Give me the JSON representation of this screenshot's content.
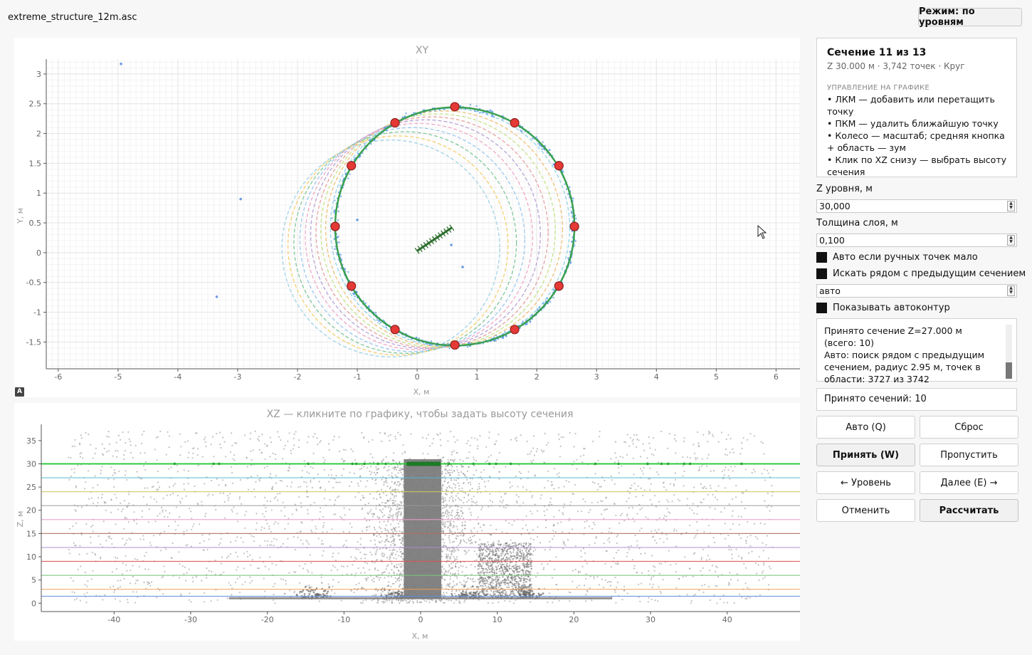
{
  "window": {
    "filename": "extreme_structure_12m.asc"
  },
  "toolbar": {
    "mode_label": "Режим: по уровням"
  },
  "xy_plot": {
    "title": "XY",
    "xlabel": "X, м",
    "ylabel": "Y, м",
    "xticks": [
      "-6",
      "-5",
      "-4",
      "-3",
      "-2",
      "-1",
      "0",
      "1",
      "2",
      "3",
      "4",
      "5",
      "6"
    ],
    "yticks": [
      "3",
      "2.5",
      "2",
      "1.5",
      "1",
      "0.5",
      "0",
      "-0.5",
      "-1",
      "-1.5"
    ],
    "badge": "A"
  },
  "xz_plot": {
    "title": "XZ — кликните по графику, чтобы задать высоту сечения",
    "xlabel": "X, м",
    "ylabel": "Z, м",
    "xticks": [
      "-40",
      "-30",
      "-20",
      "-10",
      "0",
      "10",
      "20",
      "30",
      "40"
    ],
    "yticks": [
      "35",
      "30",
      "25",
      "20",
      "15",
      "10",
      "5",
      "0"
    ]
  },
  "info": {
    "title": "Сечение 11 из 13",
    "subtitle": "Z 30.000 м · 3,742 точек · Круг",
    "controls_heading": "УПРАВЛЕНИЕ НА ГРАФИКЕ",
    "hint1": "• ЛКМ — добавить или перетащить точку",
    "hint2": "• ПКМ — удалить ближайшую точку",
    "hint3": "• Колесо — масштаб; средняя кнопка + область — зум",
    "hint4": "• Клик по XZ снизу — выбрать высоту сечения"
  },
  "form": {
    "z_label": "Z уровня, м",
    "z_value": "30,000",
    "thickness_label": "Толщина слоя, м",
    "thickness_value": "0,100",
    "auto_if_few": "Авто если ручных точек мало",
    "search_near_prev": "Искать рядом с предыдущим сечением",
    "auto_value": "авто",
    "show_autocontour": "Показывать автоконтур"
  },
  "log": {
    "line1": "Принято сечение Z=27.000 м (всего: 10)",
    "line2": "Авто: поиск рядом с предыдущим сечением, радиус 2.95 м, точек в области: 3727 из 3742"
  },
  "status": {
    "accepted": "Принято сечений: 10"
  },
  "buttons": {
    "auto": "Авто (Q)",
    "reset": "Сброс",
    "accept": "Принять (W)",
    "skip": "Пропустить",
    "prev_level": "← Уровень",
    "next": "Далее (E) →",
    "undo": "Отменить",
    "compute": "Рассчитать"
  },
  "colors": {
    "contour": "#3aa050",
    "control_point": "#e53935",
    "current_level": "#2ecc40",
    "scatter": "#888888"
  },
  "chart_data": [
    {
      "type": "scatter",
      "title": "XY",
      "xlabel": "X, м",
      "ylabel": "Y, м",
      "xlim": [
        -6.2,
        6.4
      ],
      "ylim": [
        -1.95,
        3.25
      ],
      "grid": true,
      "fitted_circle": {
        "cx": 0.63,
        "cy": 0.44,
        "r": 2.0
      },
      "control_points": [
        {
          "x": 0.63,
          "y": 2.45
        },
        {
          "x": 1.63,
          "y": 2.18
        },
        {
          "x": 2.37,
          "y": 1.46
        },
        {
          "x": 2.63,
          "y": 0.44
        },
        {
          "x": 2.37,
          "y": -0.56
        },
        {
          "x": 1.63,
          "y": -1.29
        },
        {
          "x": 0.63,
          "y": -1.55
        },
        {
          "x": -0.37,
          "y": -1.29
        },
        {
          "x": -1.1,
          "y": -0.56
        },
        {
          "x": -1.37,
          "y": 0.44
        },
        {
          "x": -1.1,
          "y": 1.46
        },
        {
          "x": -0.37,
          "y": 2.18
        }
      ],
      "outliers": [
        {
          "x": -4.95,
          "y": 3.17
        },
        {
          "x": -2.95,
          "y": 0.9
        },
        {
          "x": -3.35,
          "y": -0.74
        },
        {
          "x": -1.0,
          "y": 0.55
        },
        {
          "x": 0.57,
          "y": 0.13
        },
        {
          "x": 0.76,
          "y": -0.24
        }
      ],
      "previous_sections": [
        {
          "cx": 0.55,
          "cy": 0.42,
          "r": 2.0,
          "color": "#8fd3e8"
        },
        {
          "cx": 0.45,
          "cy": 0.4,
          "r": 1.98,
          "color": "#f0c27a"
        },
        {
          "cx": 0.35,
          "cy": 0.37,
          "r": 1.96,
          "color": "#c6e38a"
        },
        {
          "cx": 0.25,
          "cy": 0.34,
          "r": 1.94,
          "color": "#e8a3a3"
        },
        {
          "cx": 0.14,
          "cy": 0.31,
          "r": 1.92,
          "color": "#b8a3d8"
        },
        {
          "cx": 0.03,
          "cy": 0.27,
          "r": 1.9,
          "color": "#f0a8c8"
        },
        {
          "cx": -0.08,
          "cy": 0.22,
          "r": 1.88,
          "color": "#9cc7ef"
        },
        {
          "cx": -0.2,
          "cy": 0.17,
          "r": 1.86,
          "color": "#7fc89a"
        },
        {
          "cx": -0.32,
          "cy": 0.12,
          "r": 1.84,
          "color": "#f4cf6e"
        },
        {
          "cx": -0.44,
          "cy": 0.07,
          "r": 1.82,
          "color": "#9fd3e6"
        }
      ],
      "structure_line": {
        "x1": 0.0,
        "y1": 0.03,
        "x2": 0.58,
        "y2": 0.42
      }
    },
    {
      "type": "scatter",
      "title": "XZ — кликните по графику, чтобы задать высоту сечения",
      "xlabel": "X, м",
      "ylabel": "Z, м",
      "xlim": [
        -49.5,
        49.5
      ],
      "ylim": [
        -1.8,
        38.5
      ],
      "grid": false,
      "current_level": 30,
      "levels": [
        {
          "z": 1.5,
          "color": "#5b8fd6"
        },
        {
          "z": 3.0,
          "color": "#f0a050"
        },
        {
          "z": 6.0,
          "color": "#7cc47c"
        },
        {
          "z": 9.0,
          "color": "#e05050"
        },
        {
          "z": 12.0,
          "color": "#a890d0"
        },
        {
          "z": 15.0,
          "color": "#b07060"
        },
        {
          "z": 18.0,
          "color": "#e8a0c8"
        },
        {
          "z": 21.0,
          "color": "#999999"
        },
        {
          "z": 24.0,
          "color": "#c8c860"
        },
        {
          "z": 27.0,
          "color": "#50b8d0"
        }
      ],
      "structures": [
        {
          "name": "column",
          "x0": -2.2,
          "x1": 2.7,
          "z0": 1.0,
          "z1": 31.0
        },
        {
          "name": "block",
          "x0": 8.5,
          "x1": 13.5,
          "z0": 1.0,
          "z1": 13.0
        },
        {
          "name": "base",
          "x0": -25.0,
          "x1": 25.0,
          "z0": 0.9,
          "z1": 1.3
        }
      ]
    }
  ]
}
